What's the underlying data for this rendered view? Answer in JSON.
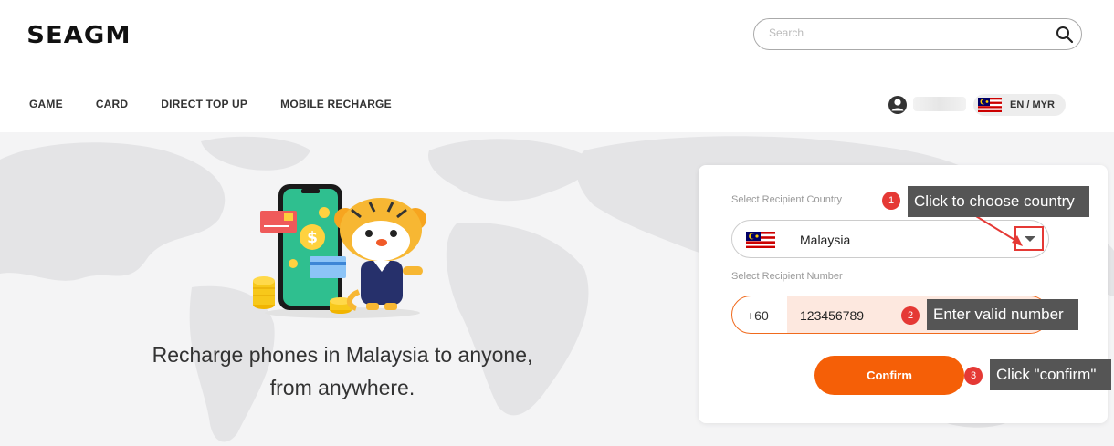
{
  "header": {
    "logo": "SEAGM",
    "search": {
      "placeholder": "Search"
    }
  },
  "nav": {
    "items": [
      {
        "label": "GAME"
      },
      {
        "label": "CARD"
      },
      {
        "label": "DIRECT TOP UP"
      },
      {
        "label": "MOBILE RECHARGE"
      }
    ]
  },
  "account": {
    "lang_label": "EN / MYR"
  },
  "hero": {
    "tagline_line1": "Recharge phones in Malaysia to anyone,",
    "tagline_line2": "from anywhere."
  },
  "form": {
    "country_label": "Select Recipient Country",
    "country_value": "Malaysia",
    "number_label": "Select Recipient Number",
    "dial_code": "+60",
    "number_value": "123456789",
    "confirm_label": "Confirm"
  },
  "annotations": [
    {
      "badge": "1",
      "text": "Click to choose country"
    },
    {
      "badge": "2",
      "text": "Enter valid number"
    },
    {
      "badge": "3",
      "text": "Click \"confirm\""
    }
  ],
  "colors": {
    "accent": "#f55f07",
    "annotation_red": "#e53935",
    "tooltip_bg": "#555555"
  }
}
